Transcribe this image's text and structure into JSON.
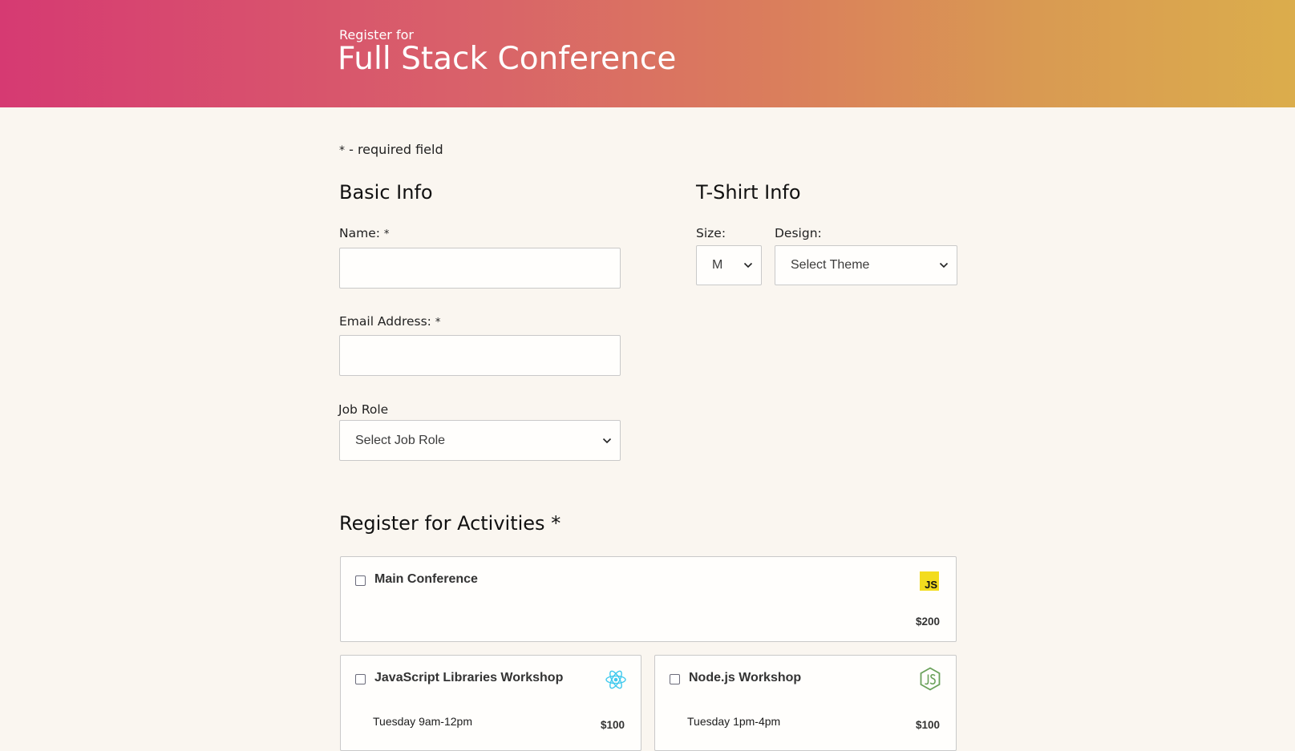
{
  "header": {
    "subtitle": "Register for",
    "title": "Full Stack Conference"
  },
  "required_note": {
    "star": "*",
    "text": " - required field"
  },
  "basic_info": {
    "heading": "Basic Info",
    "name_label": "Name:",
    "name_value": "",
    "email_label": "Email Address:",
    "email_value": "",
    "required_star": "*",
    "job_role_label": "Job Role",
    "job_role_selected": "Select Job Role"
  },
  "tshirt_info": {
    "heading": "T-Shirt Info",
    "size_label": "Size:",
    "size_selected": "M",
    "design_label": "Design:",
    "design_selected": "Select Theme"
  },
  "activities": {
    "heading": "Register for Activities",
    "required_star": "*",
    "items": [
      {
        "title": "Main Conference",
        "time": "",
        "price": "$200",
        "icon": "javascript-icon",
        "checked": false
      },
      {
        "title": "JavaScript Libraries Workshop",
        "time": "Tuesday 9am-12pm",
        "price": "$100",
        "icon": "react-icon",
        "checked": false
      },
      {
        "title": "Node.js Workshop",
        "time": "Tuesday 1pm-4pm",
        "price": "$100",
        "icon": "nodejs-icon",
        "checked": false
      }
    ],
    "js_badge_text": "JS"
  },
  "colors": {
    "header_gradient_start": "#d63a72",
    "header_gradient_end": "#dbad4c",
    "page_background": "#faf6f0",
    "javascript_yellow": "#f3dc1e",
    "react_cyan": "#3fc9ee",
    "node_green": "#6aa15a"
  }
}
